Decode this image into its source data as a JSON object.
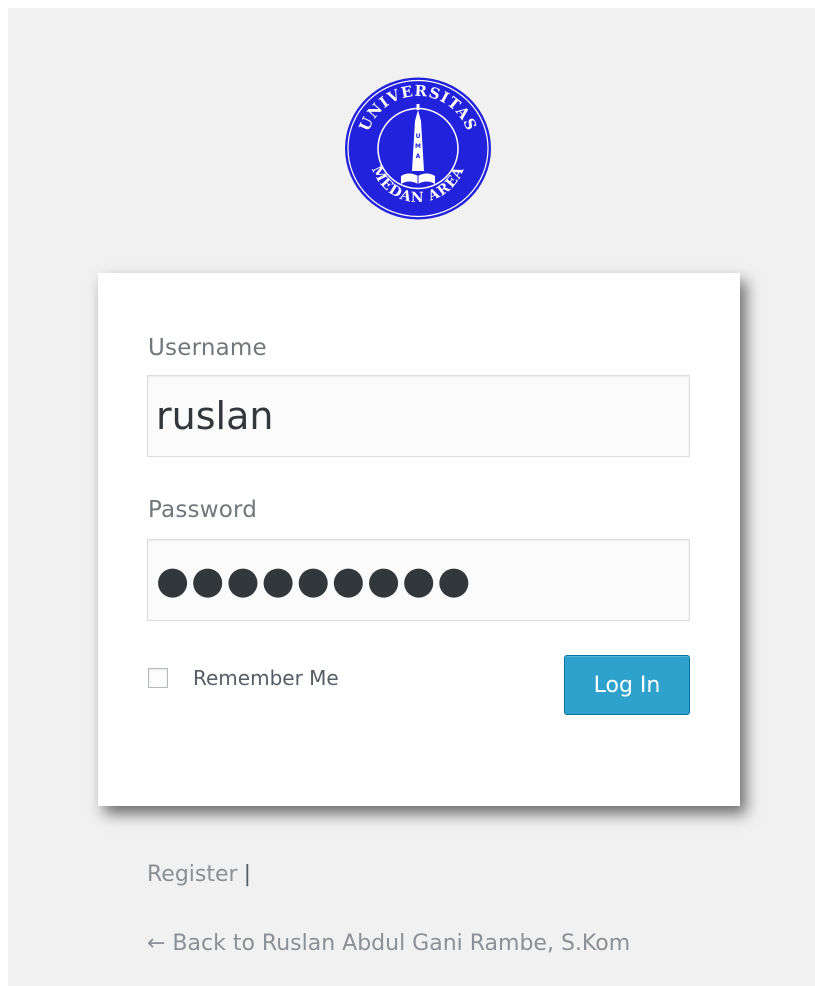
{
  "logo": {
    "top_text": "UNIVERSITAS",
    "bottom_text": "MEDAN AREA",
    "monogram": "UMA",
    "color": "#2222dd"
  },
  "form": {
    "username_label": "Username",
    "username_value": "ruslan",
    "password_label": "Password",
    "password_mask": "●●●●●●●●●",
    "remember_label": "Remember Me",
    "remember_checked": false,
    "login_label": "Log In"
  },
  "nav": {
    "register_label": "Register",
    "separator": "|",
    "back_label": "← Back to Ruslan Abdul Gani Rambe, S.Kom"
  },
  "colors": {
    "background": "#f1f1f1",
    "button": "#2ea2cc",
    "button_border": "#0074a2"
  }
}
